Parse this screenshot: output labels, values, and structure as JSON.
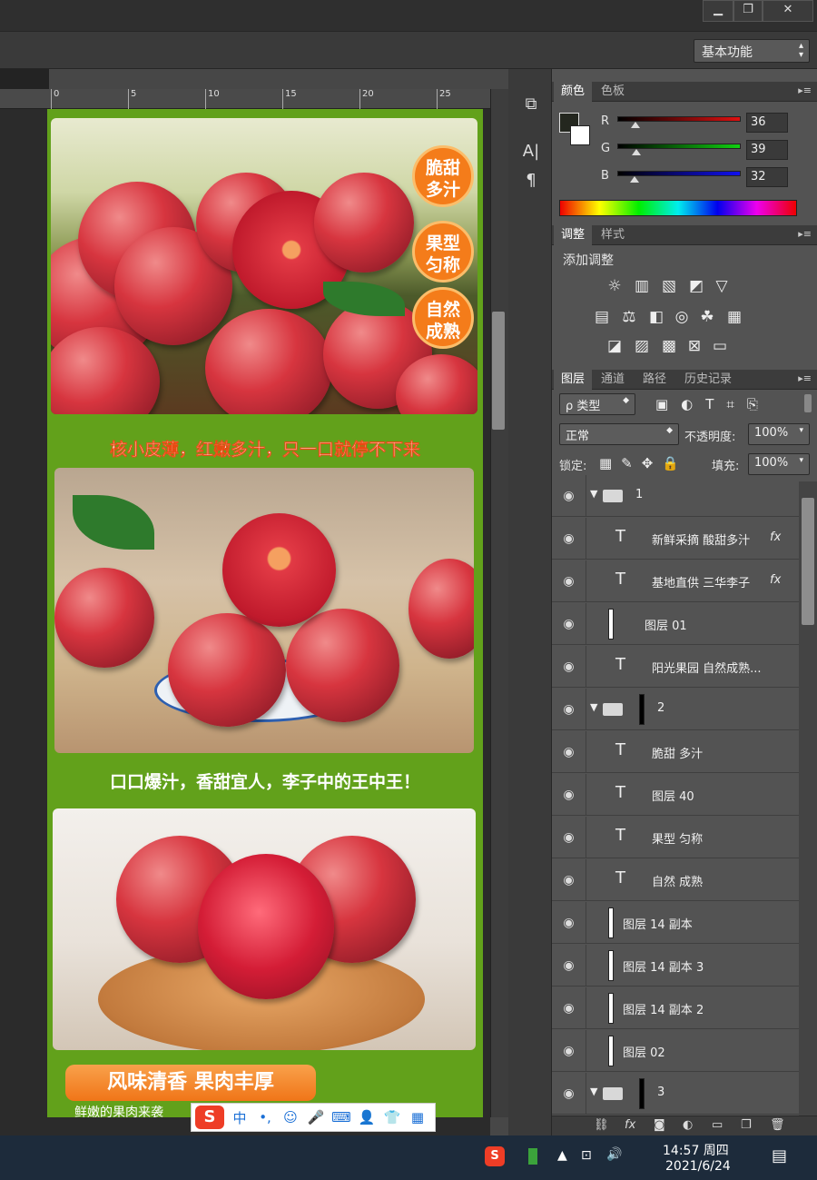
{
  "window": {
    "min_glyph": "▁",
    "restore_glyph": "❐",
    "close_glyph": "✕"
  },
  "workspace": {
    "label": "基本功能"
  },
  "ruler": {
    "ticks": [
      "0",
      "5",
      "10",
      "15",
      "20",
      "25"
    ]
  },
  "canvas": {
    "badges": [
      {
        "l1": "脆甜",
        "l2": "多汁"
      },
      {
        "l1": "果型",
        "l2": "匀称"
      },
      {
        "l1": "自然",
        "l2": "成熟"
      }
    ],
    "headline1": "核小皮薄，红嫩多汁，只一口就停不下来",
    "headline2": "口口爆汁，香甜宜人，李子中的王中王！",
    "pill": "风味清香 果肉丰厚",
    "subtext": "鲜嫩的果肉来袭"
  },
  "ime": {
    "logo": "S",
    "lang": "中",
    "items": [
      "•,",
      "☺",
      "🎤",
      "⌨",
      "👤",
      "👕",
      "▦"
    ]
  },
  "color_panel": {
    "tabs": [
      "颜色",
      "色板"
    ],
    "channels": [
      {
        "label": "R",
        "value": "36",
        "color": "#d42020"
      },
      {
        "label": "G",
        "value": "39",
        "color": "#22b022"
      },
      {
        "label": "B",
        "value": "32",
        "color": "#2a2adf"
      }
    ],
    "channel_fraction": [
      0.14,
      0.15,
      0.13
    ]
  },
  "adjust_panel": {
    "tabs": [
      "调整",
      "样式"
    ],
    "title": "添加调整"
  },
  "layers_panel": {
    "tabs": [
      "图层",
      "通道",
      "路径",
      "历史记录"
    ],
    "filter": "ρ 类型",
    "blend": "正常",
    "opacity_label": "不透明度:",
    "opacity": "100%",
    "lock_label": "锁定:",
    "fill_label": "填充:",
    "fill": "100%",
    "layers": [
      {
        "name": "1",
        "kind": "group",
        "indent": 0
      },
      {
        "name": "新鲜采摘 酸甜多汁",
        "kind": "text",
        "indent": 1,
        "fx": "fx"
      },
      {
        "name": "基地直供 三华李子",
        "kind": "text",
        "indent": 1,
        "fx": "fx"
      },
      {
        "name": "图层 01",
        "kind": "layer",
        "indent": 1
      },
      {
        "name": "阳光果园 自然成熟...",
        "kind": "text",
        "indent": 1
      },
      {
        "name": "2",
        "kind": "group",
        "indent": 0
      },
      {
        "name": "脆甜 多汁",
        "kind": "text",
        "indent": 1
      },
      {
        "name": "图层 40",
        "kind": "text",
        "indent": 1
      },
      {
        "name": "果型 匀称",
        "kind": "text",
        "indent": 1
      },
      {
        "name": "自然 成熟",
        "kind": "text",
        "indent": 1
      },
      {
        "name": "图层 14 副本",
        "kind": "layer",
        "indent": 1
      },
      {
        "name": "图层 14 副本 3",
        "kind": "layer",
        "indent": 1
      },
      {
        "name": "图层 14 副本 2",
        "kind": "layer",
        "indent": 1
      },
      {
        "name": "图层 02",
        "kind": "layer",
        "indent": 1
      },
      {
        "name": "3",
        "kind": "group",
        "indent": 0
      }
    ],
    "footer_icons": [
      "⛓",
      "fx",
      "◙",
      "◐",
      "▭",
      "❐",
      "🗑"
    ]
  },
  "taskbar": {
    "time": "14:57 周四",
    "date": "2021/6/24"
  }
}
